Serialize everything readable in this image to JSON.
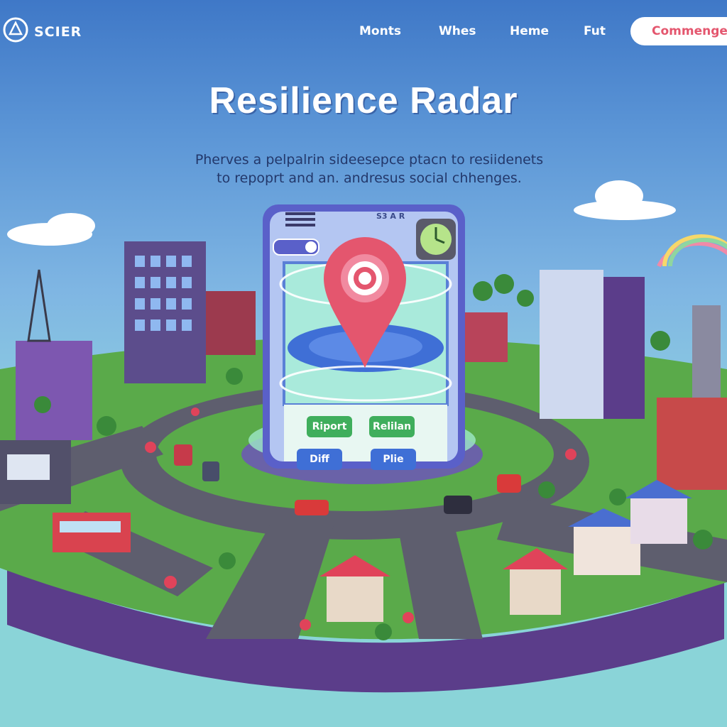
{
  "brand": {
    "name": "SCIER"
  },
  "nav": {
    "links": [
      "Monts",
      "Whes",
      "Heme",
      "Fut"
    ],
    "cta": "Commenge"
  },
  "hero": {
    "title": "Resilience Radar",
    "subtitle_line1": "Pherves a pelpalrin sideesepce ptacn to resiidenets",
    "subtitle_line2": "to repoprt and an. andresus social chhenges."
  },
  "app": {
    "header_label": "S3 A R",
    "buttons": [
      "Riport",
      "Relilan",
      "Diff",
      "Plie"
    ]
  },
  "colors": {
    "accent": "#e4566e",
    "app_green": "#3fae5c",
    "app_blue": "#3f6fd6",
    "grass": "#5aaa4a",
    "road": "#5e5e6e"
  },
  "icons": [
    "logo-icon",
    "location-pin-icon",
    "clock-icon",
    "toggle-icon",
    "menu-icon"
  ]
}
